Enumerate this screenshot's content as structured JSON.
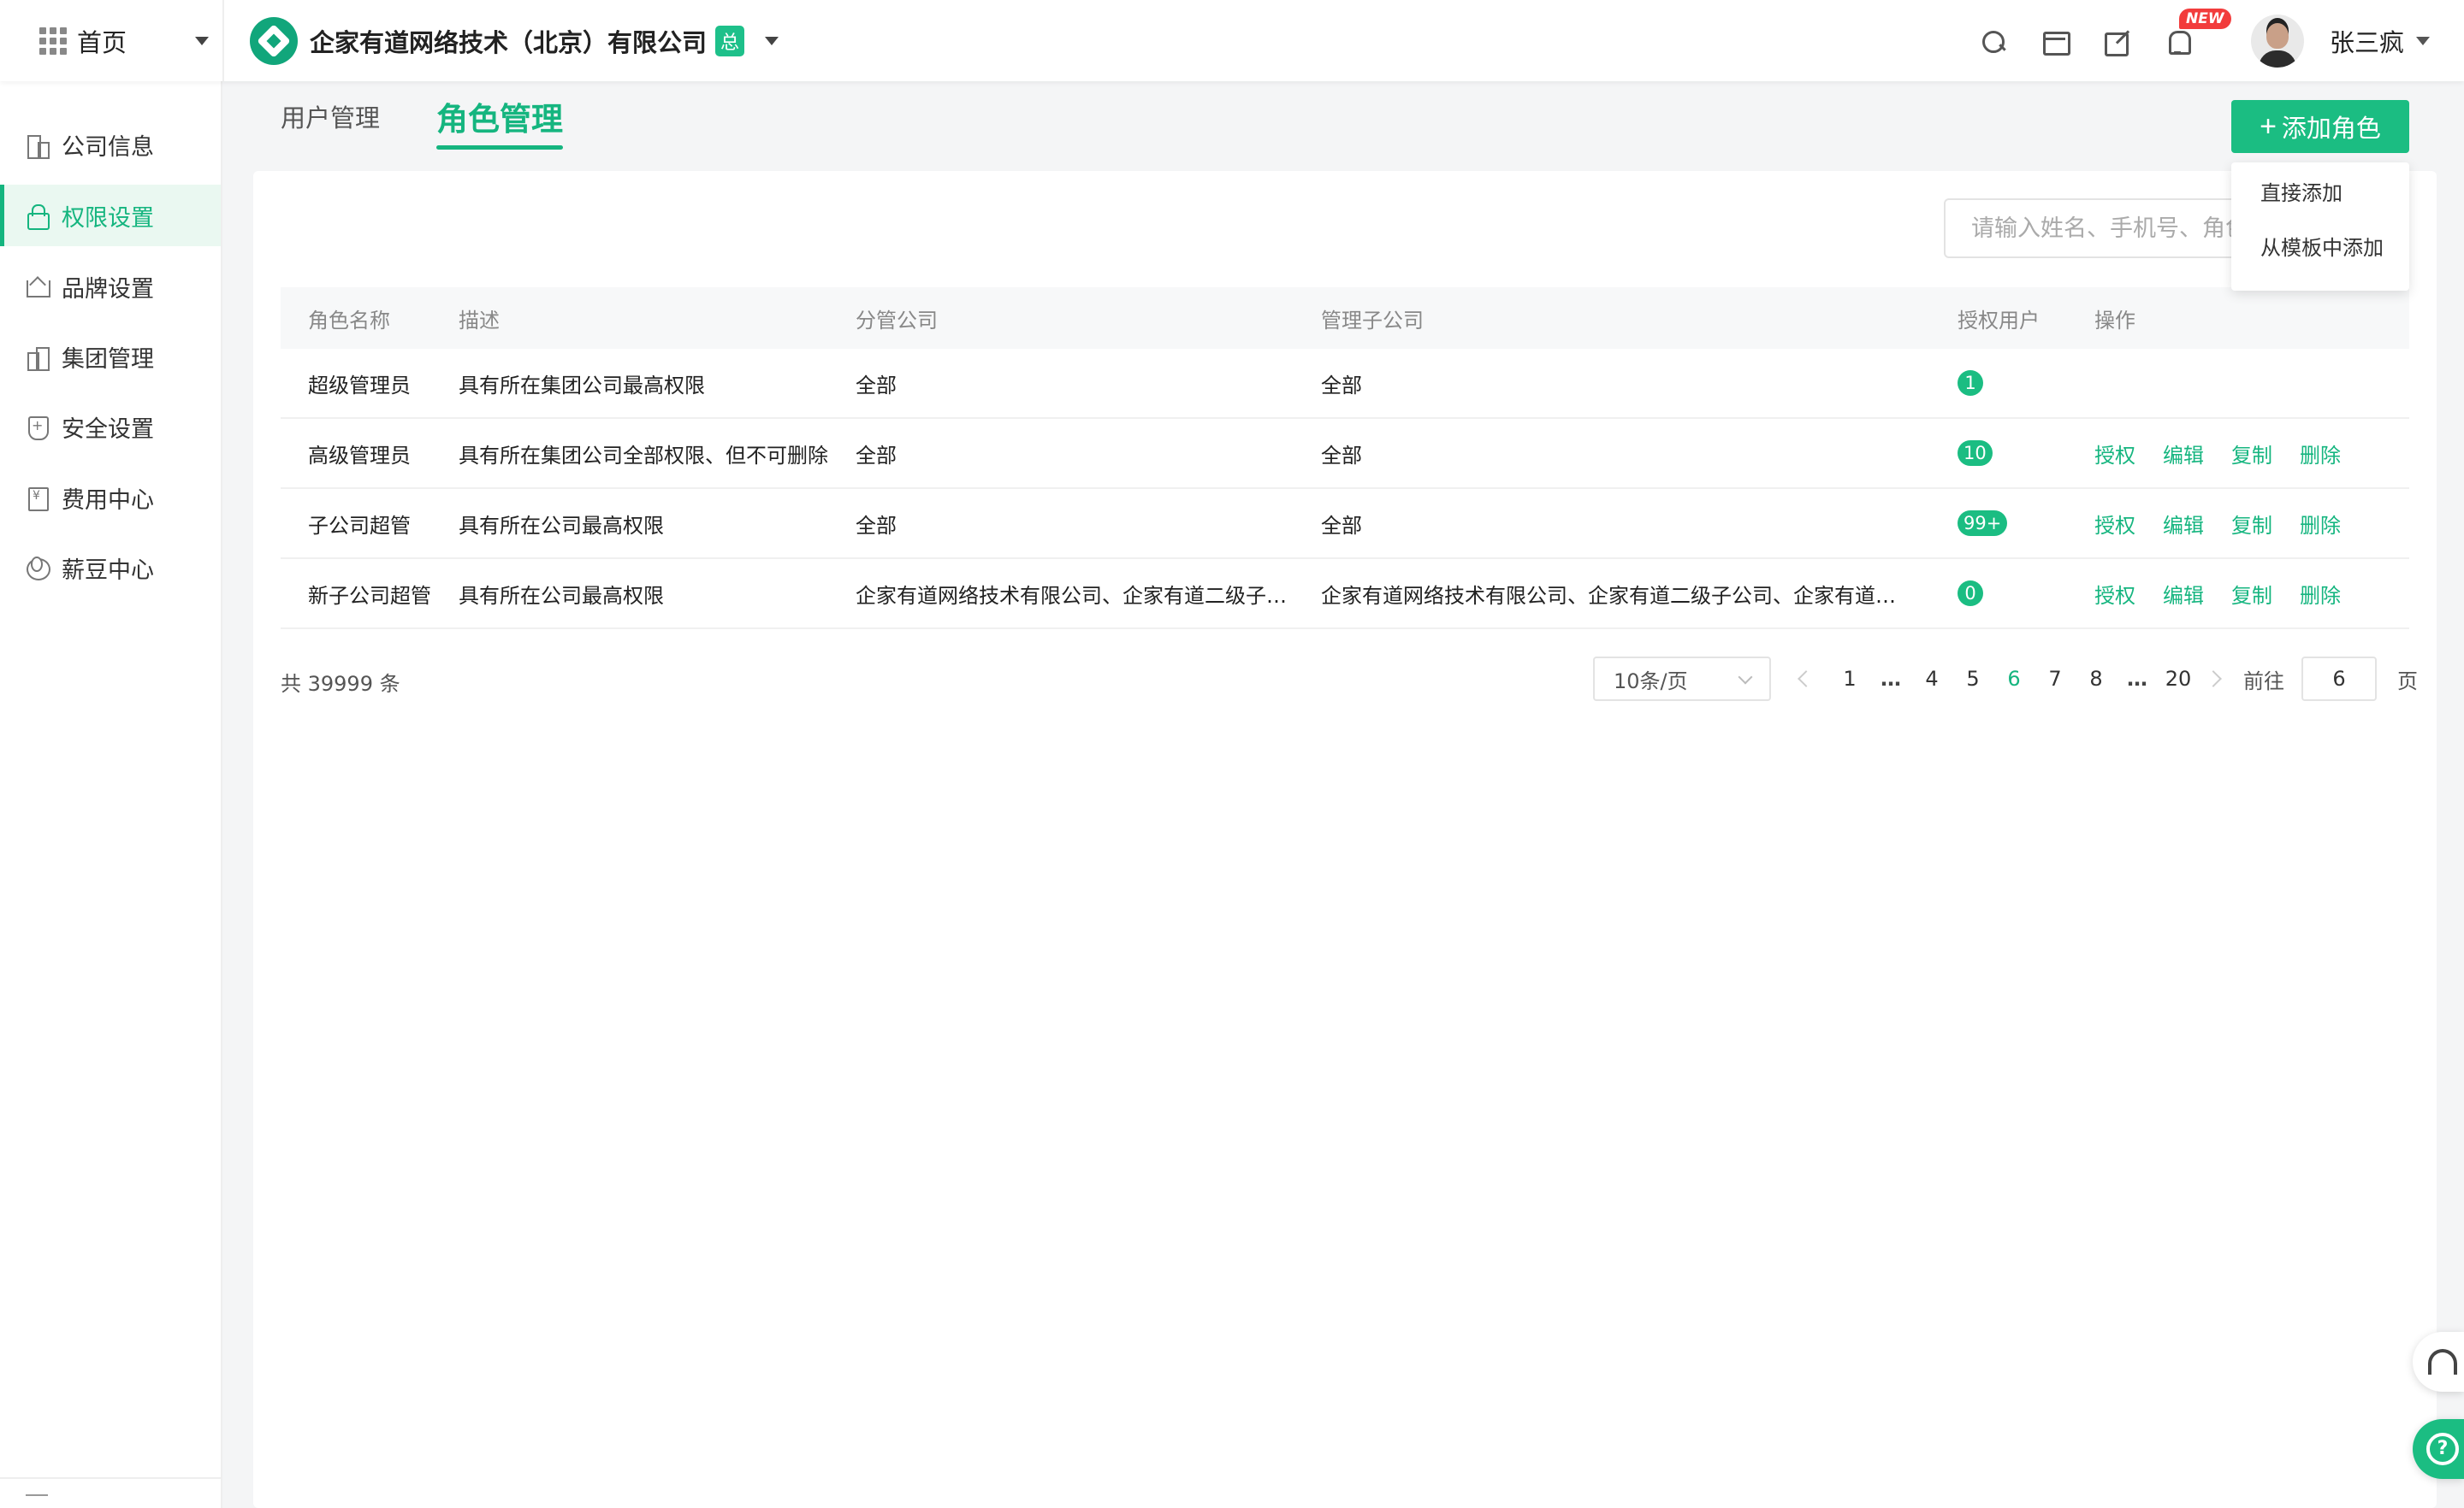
{
  "header": {
    "home_label": "首页",
    "company_name": "企家有道网络技术（北京）有限公司",
    "company_tag": "总",
    "new_badge": "NEW",
    "user_name": "张三疯",
    "icons": [
      "grid-icon",
      "search-icon",
      "store-icon",
      "edit-icon",
      "bell-icon"
    ]
  },
  "sidebar": {
    "items": [
      {
        "label": "公司信息",
        "icon": "building-icon"
      },
      {
        "label": "权限设置",
        "icon": "lock-icon",
        "active": true
      },
      {
        "label": "品牌设置",
        "icon": "crown-icon"
      },
      {
        "label": "集团管理",
        "icon": "group-icon"
      },
      {
        "label": "安全设置",
        "icon": "shield-icon"
      },
      {
        "label": "费用中心",
        "icon": "fee-icon"
      },
      {
        "label": "薪豆中心",
        "icon": "bean-icon"
      }
    ]
  },
  "tabs": [
    {
      "label": "用户管理",
      "active": false
    },
    {
      "label": "角色管理",
      "active": true
    }
  ],
  "toolbar": {
    "add_role_label": "添加角色",
    "search_placeholder": "请输入姓名、手机号、角色名称"
  },
  "dropdown": {
    "items": [
      "直接添加",
      "从模板中添加"
    ]
  },
  "table": {
    "columns": [
      "角色名称",
      "描述",
      "分管公司",
      "管理子公司",
      "授权用户",
      "操作"
    ],
    "rows": [
      {
        "name": "超级管理员",
        "desc": "具有所在集团公司最高权限",
        "branch": "全部",
        "sub": "全部",
        "users": "1",
        "ops": []
      },
      {
        "name": "高级管理员",
        "desc": "具有所在集团公司全部权限、但不可删除",
        "branch": "全部",
        "sub": "全部",
        "users": "10",
        "ops": [
          "授权",
          "编辑",
          "复制",
          "删除"
        ]
      },
      {
        "name": "子公司超管",
        "desc": "具有所在公司最高权限",
        "branch": "全部",
        "sub": "全部",
        "users": "99+",
        "ops": [
          "授权",
          "编辑",
          "复制",
          "删除"
        ]
      },
      {
        "name": "新子公司超管",
        "desc": "具有所在公司最高权限",
        "branch": "企家有道网络技术有限公司、企家有道二级子公司",
        "sub": "企家有道网络技术有限公司、企家有道二级子公司、企家有道三级子公司",
        "users": "0",
        "ops": [
          "授权",
          "编辑",
          "复制",
          "删除"
        ]
      }
    ]
  },
  "pagination": {
    "total_text": "共 39999 条",
    "page_size": "10条/页",
    "pages": [
      "1",
      "…",
      "4",
      "5",
      "6",
      "7",
      "8",
      "…",
      "20"
    ],
    "current": "6",
    "jump_label": "前往",
    "jump_value": "6",
    "page_suffix": "页"
  },
  "colors": {
    "accent": "#1bbd82",
    "badge_new": "#f23c3c"
  }
}
